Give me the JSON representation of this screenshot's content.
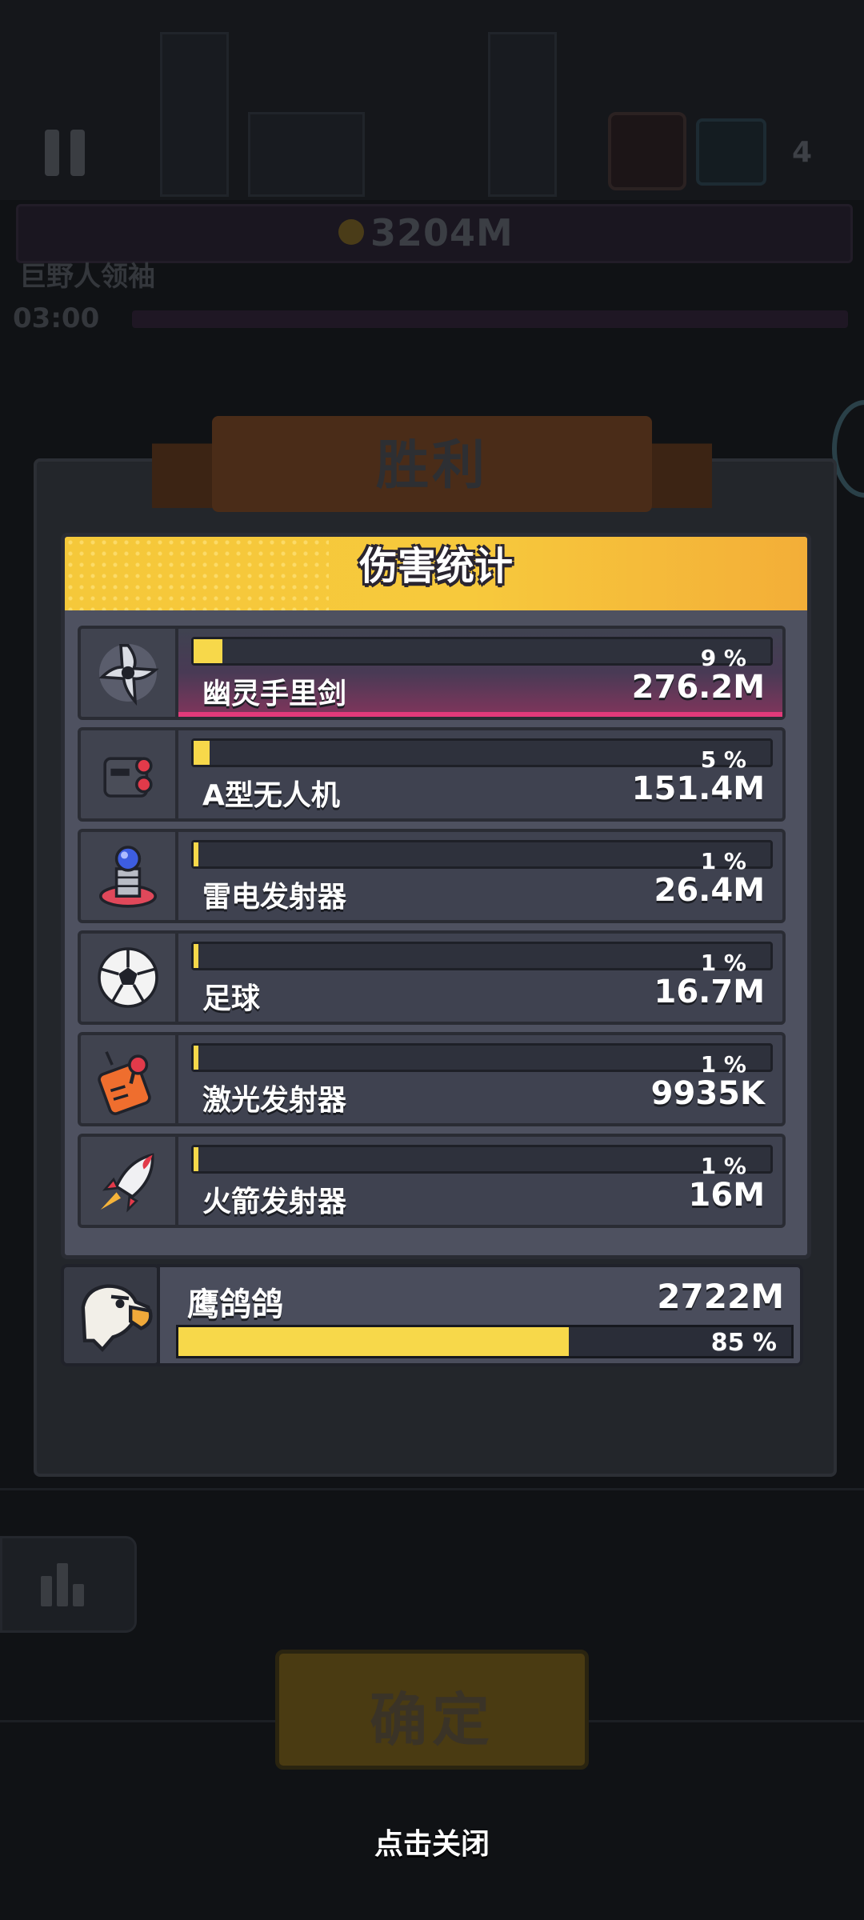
{
  "hud": {
    "score": "3204M",
    "boss_name": "巨野人领袖",
    "timer": "03:00",
    "wave_count": "4"
  },
  "result": {
    "title": "胜利",
    "stats_title": "伤害统计"
  },
  "weapons": [
    {
      "name": "幽灵手里剑",
      "damage": "276.2M",
      "percent_label": "9 %",
      "percent": 9,
      "icon": "ghost-shuriken-icon",
      "top": true
    },
    {
      "name": "A型无人机",
      "damage": "151.4M",
      "percent_label": "5 %",
      "percent": 5,
      "icon": "drone-icon"
    },
    {
      "name": "雷电发射器",
      "damage": "26.4M",
      "percent_label": "1 %",
      "percent": 1,
      "icon": "lightning-emitter-icon"
    },
    {
      "name": "足球",
      "damage": "16.7M",
      "percent_label": "1 %",
      "percent": 1,
      "icon": "soccer-ball-icon"
    },
    {
      "name": "激光发射器",
      "damage": "9935K",
      "percent_label": "1 %",
      "percent": 1,
      "icon": "laser-emitter-icon"
    },
    {
      "name": "火箭发射器",
      "damage": "16M",
      "percent_label": "1 %",
      "percent": 1,
      "icon": "rocket-launcher-icon"
    }
  ],
  "pet": {
    "name": "鹰鸽鸽",
    "damage": "2722M",
    "percent_label": "85 %",
    "percent": 85,
    "icon": "eagle-icon"
  },
  "buttons": {
    "confirm": "确定",
    "close_hint": "点击关闭"
  },
  "colors": {
    "bar_fill": "#f7d84a",
    "header": "#f5c83a",
    "top_row_accent": "#e23a7a"
  }
}
